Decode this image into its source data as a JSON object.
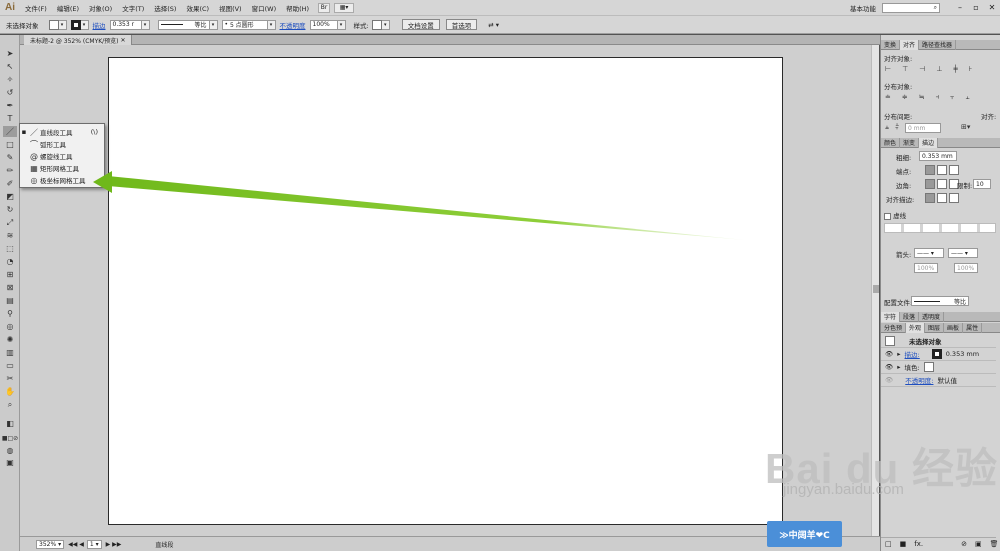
{
  "app": {
    "logo": "Ai"
  },
  "menu": {
    "items": [
      "文件(F)",
      "编辑(E)",
      "对象(O)",
      "文字(T)",
      "选择(S)",
      "效果(C)",
      "视图(V)",
      "窗口(W)",
      "帮助(H)"
    ],
    "br_button": "Br",
    "workspace": "基本功能",
    "window_controls": [
      "–",
      "▫",
      "✕"
    ]
  },
  "control_bar": {
    "selection_label": "未选择对象",
    "stroke_link": "描边",
    "stroke_value": "0.353 r",
    "stroke_profile": "等比",
    "brush": "5 点圆形",
    "opacity_link": "不透明度",
    "opacity_value": "100%",
    "style_label": "样式:",
    "doc_setup_button": "文档设置",
    "preferences_button": "首选项"
  },
  "document": {
    "tab_title": "未标题-2 @ 352% (CMYK/预览)"
  },
  "status_bar": {
    "zoom": "352%",
    "page": "1",
    "tool_name": "直线段"
  },
  "flyout": {
    "items": [
      {
        "icon": "line-segment-icon",
        "label": "直线段工具",
        "shortcut": "(\\)"
      },
      {
        "icon": "arc-icon",
        "label": "弧形工具",
        "shortcut": ""
      },
      {
        "icon": "spiral-icon",
        "label": "螺旋线工具",
        "shortcut": ""
      },
      {
        "icon": "rect-grid-icon",
        "label": "矩形网格工具",
        "shortcut": ""
      },
      {
        "icon": "polar-grid-icon",
        "label": "极坐标网格工具",
        "shortcut": ""
      }
    ]
  },
  "annotation": {
    "arrow_color": "#7dc31f"
  },
  "panels": {
    "align": {
      "tabs": [
        "变换",
        "对齐",
        "路径查找器"
      ],
      "align_objects": "对齐对象:",
      "distribute_objects": "分布对象:",
      "distribute_spacing": "分布间距:",
      "align_to": "对齐:",
      "spacing_value": "0 mm"
    },
    "stroke": {
      "tabs": [
        "颜色",
        "渐变",
        "描边"
      ],
      "weight_label": "粗细:",
      "weight_value": "0.353 mm",
      "cap_label": "端点:",
      "corner_label": "边角:",
      "limit_label": "限制:",
      "limit_value": "10",
      "align_label": "对齐描边:",
      "dashed_label": "虚线",
      "arrow_label": "箭头:",
      "scale_a": "100%",
      "scale_b": "100%",
      "profile_label": "配置文件:",
      "profile_value": "等比"
    },
    "char": {
      "tabs": [
        "字符",
        "段落",
        "透明度"
      ]
    },
    "appearance": {
      "tabs": [
        "分色预",
        "外观",
        "图层",
        "画板",
        "属性"
      ],
      "header": "未选择对象",
      "stroke_row": "描边:",
      "stroke_value": "0.353 mm",
      "fill_row": "填色:",
      "opacity_row": "不透明度:",
      "opacity_value": "默认值"
    }
  },
  "watermark": {
    "brand": "Bai du 经验",
    "url": "jingyan.baidu.com",
    "badge": "≫中阔羊❤C"
  }
}
